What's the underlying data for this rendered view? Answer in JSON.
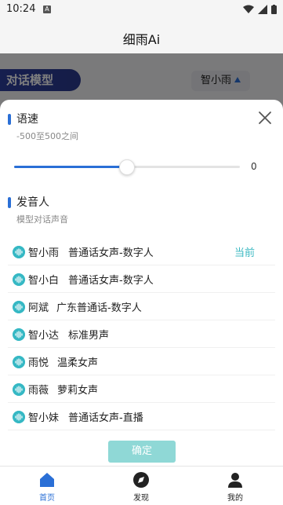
{
  "status_bar": {
    "time": "10:24",
    "notification_letter": "A"
  },
  "app": {
    "title": "细雨Ai"
  },
  "background": {
    "section_label": "对话模型",
    "selected_voice": "智小雨"
  },
  "sheet": {
    "speed": {
      "title": "语速",
      "subtitle": "-500至500之间",
      "value": "0",
      "min": -500,
      "max": 500,
      "current": 0
    },
    "speaker": {
      "title": "发音人",
      "subtitle": "模型对话声音"
    },
    "voices": [
      {
        "name": "智小雨",
        "desc": "普通话女声-数字人",
        "current_label": "当前"
      },
      {
        "name": "智小白",
        "desc": "普通话女声-数字人",
        "current_label": ""
      },
      {
        "name": "阿斌",
        "desc": "广东普通话-数字人",
        "current_label": ""
      },
      {
        "name": "智小达",
        "desc": "标准男声",
        "current_label": ""
      },
      {
        "name": "雨悦",
        "desc": "温柔女声",
        "current_label": ""
      },
      {
        "name": "雨薇",
        "desc": "萝莉女声",
        "current_label": ""
      },
      {
        "name": "智小妹",
        "desc": "普通话女声-直播",
        "current_label": ""
      }
    ],
    "confirm_label": "确定"
  },
  "tabs": [
    {
      "label": "首页",
      "icon": "home-icon",
      "active": true
    },
    {
      "label": "发现",
      "icon": "compass-icon",
      "active": false
    },
    {
      "label": "我的",
      "icon": "user-icon",
      "active": false
    }
  ],
  "colors": {
    "accent": "#2a6fd6",
    "teal": "#35b8c4",
    "confirm": "#8fd8d6"
  }
}
